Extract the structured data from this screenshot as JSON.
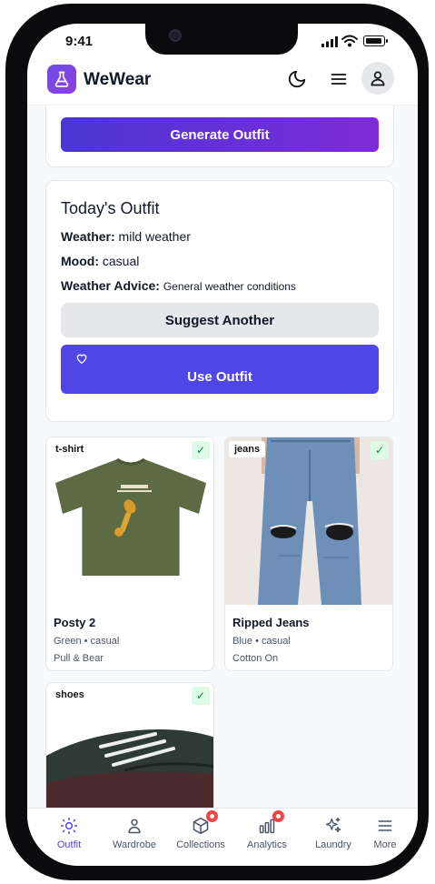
{
  "status": {
    "time": "9:41"
  },
  "app": {
    "name": "WeWear"
  },
  "generate": {
    "label": "Generate Outfit"
  },
  "today": {
    "title": "Today's Outfit",
    "weather_label": "Weather:",
    "weather_value": "mild weather",
    "mood_label": "Mood:",
    "mood_value": "casual",
    "advice_label": "Weather Advice:",
    "advice_value": "General weather conditions",
    "suggest_label": "Suggest Another",
    "use_label": "Use Outfit"
  },
  "items": [
    {
      "tag": "t-shirt",
      "name": "Posty 2",
      "meta": "Green • casual",
      "brand": "Pull & Bear",
      "selected": true
    },
    {
      "tag": "jeans",
      "name": "Ripped Jeans",
      "meta": "Blue • casual",
      "brand": "Cotton On",
      "selected": true
    },
    {
      "tag": "shoes",
      "selected": true
    }
  ],
  "check_glyph": "✓",
  "tabs": [
    {
      "label": "Outfit",
      "icon": "sun-icon",
      "active": true
    },
    {
      "label": "Wardrobe",
      "icon": "person-icon"
    },
    {
      "label": "Collections",
      "icon": "box-icon",
      "badge": true
    },
    {
      "label": "Analytics",
      "icon": "bar-chart-icon",
      "badge": true
    },
    {
      "label": "Laundry",
      "icon": "sparkles-icon"
    },
    {
      "label": "More",
      "icon": "menu-icon"
    }
  ],
  "colors": {
    "accent": "#4f46e5",
    "gradient_start": "#4b36d6",
    "gradient_end": "#7e2bd6",
    "badge": "#ef4444"
  }
}
